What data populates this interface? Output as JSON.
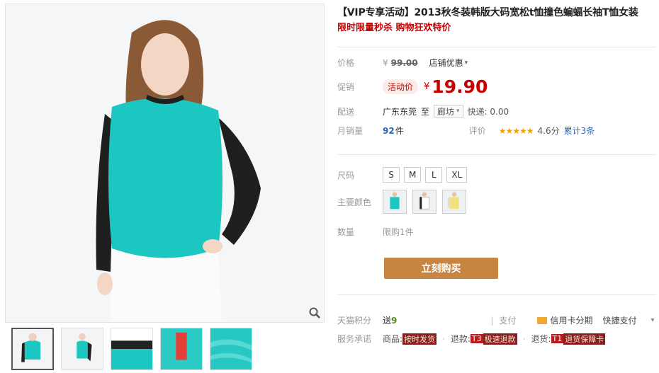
{
  "product": {
    "title": "【VIP专享活动】2013秋冬装韩版大码宽松t恤撞色蝙蝠长袖T恤女装",
    "subtitle": "限时限量秒杀 购物狂欢特价"
  },
  "price": {
    "label": "价格",
    "currency": "¥",
    "original": "99.00",
    "shop_promo": "店铺优惠"
  },
  "promo": {
    "label": "促销",
    "tag": "活动价",
    "currency": "¥",
    "price": "19.90"
  },
  "delivery": {
    "label": "配送",
    "from": "广东东莞",
    "to_word": "至",
    "destination": "廊坊",
    "express": "快递: 0.00"
  },
  "sales": {
    "label": "月销量",
    "count": "92",
    "unit": "件",
    "rating_label": "评价",
    "stars": "★★★★★",
    "score": "4.6分",
    "reviews": "累计3条"
  },
  "options": {
    "size_label": "尺码",
    "sizes": [
      "S",
      "M",
      "L",
      "XL"
    ],
    "color_label": "主要颜色",
    "quantity_label": "数量",
    "quantity_limit": "限购1件"
  },
  "buy_button": "立刻购买",
  "points": {
    "label": "天猫积分",
    "give": "送",
    "value": "9",
    "pay_label": "支付",
    "credit": "信用卡分期",
    "quickpay": "快捷支付"
  },
  "service": {
    "label": "服务承诺",
    "goods": "商品:",
    "goods_tag": "按时发货",
    "refund": "退款:",
    "refund_code": "T3",
    "refund_tag": "极速退款",
    "return": "退货:",
    "return_code": "T1",
    "return_tag": "退货保障卡"
  },
  "colors": {
    "accent_red": "#c40000",
    "buy_button": "#c88542",
    "link_blue": "#2b67b6",
    "shirt_teal": "#1cc7c1"
  },
  "icons": [
    "zoom-icon",
    "chevron-down-icon",
    "credit-card-icon",
    "star-icon"
  ]
}
